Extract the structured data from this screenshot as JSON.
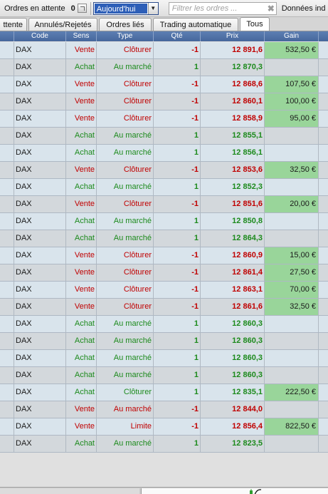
{
  "toolbar": {
    "pending_label": "Ordres en attente",
    "pending_count": "0",
    "period_value": "Aujourd'hui",
    "filter_placeholder": "Filtrer les ordres ...",
    "data_label": "Données ind"
  },
  "tabs": [
    {
      "label": "ttente",
      "active": false
    },
    {
      "label": "Annulés/Rejetés",
      "active": false
    },
    {
      "label": "Ordres liés",
      "active": false
    },
    {
      "label": "Trading automatique",
      "active": false
    },
    {
      "label": "Tous",
      "active": true
    }
  ],
  "columns": [
    "Code",
    "Sens",
    "Type",
    "Qté",
    "Prix",
    "Gain"
  ],
  "colors": {
    "sell": "#c00000",
    "buy": "#1c8a1c",
    "gain_positive": "#99d59a",
    "header": "#4f71a7"
  },
  "orders": [
    {
      "code": "DAX",
      "sens": "Vente",
      "type": "Clôturer",
      "qte": "-1",
      "prix": "12 891,6",
      "gain": "532,50 €"
    },
    {
      "code": "DAX",
      "sens": "Achat",
      "type": "Au marché",
      "qte": "1",
      "prix": "12 870,3",
      "gain": ""
    },
    {
      "code": "DAX",
      "sens": "Vente",
      "type": "Clôturer",
      "qte": "-1",
      "prix": "12 868,6",
      "gain": "107,50 €"
    },
    {
      "code": "DAX",
      "sens": "Vente",
      "type": "Clôturer",
      "qte": "-1",
      "prix": "12 860,1",
      "gain": "100,00 €"
    },
    {
      "code": "DAX",
      "sens": "Vente",
      "type": "Clôturer",
      "qte": "-1",
      "prix": "12 858,9",
      "gain": "95,00 €"
    },
    {
      "code": "DAX",
      "sens": "Achat",
      "type": "Au marché",
      "qte": "1",
      "prix": "12 855,1",
      "gain": ""
    },
    {
      "code": "DAX",
      "sens": "Achat",
      "type": "Au marché",
      "qte": "1",
      "prix": "12 856,1",
      "gain": ""
    },
    {
      "code": "DAX",
      "sens": "Vente",
      "type": "Clôturer",
      "qte": "-1",
      "prix": "12 853,6",
      "gain": "32,50 €"
    },
    {
      "code": "DAX",
      "sens": "Achat",
      "type": "Au marché",
      "qte": "1",
      "prix": "12 852,3",
      "gain": ""
    },
    {
      "code": "DAX",
      "sens": "Vente",
      "type": "Clôturer",
      "qte": "-1",
      "prix": "12 851,6",
      "gain": "20,00 €"
    },
    {
      "code": "DAX",
      "sens": "Achat",
      "type": "Au marché",
      "qte": "1",
      "prix": "12 850,8",
      "gain": ""
    },
    {
      "code": "DAX",
      "sens": "Achat",
      "type": "Au marché",
      "qte": "1",
      "prix": "12 864,3",
      "gain": ""
    },
    {
      "code": "DAX",
      "sens": "Vente",
      "type": "Clôturer",
      "qte": "-1",
      "prix": "12 860,9",
      "gain": "15,00 €"
    },
    {
      "code": "DAX",
      "sens": "Vente",
      "type": "Clôturer",
      "qte": "-1",
      "prix": "12 861,4",
      "gain": "27,50 €"
    },
    {
      "code": "DAX",
      "sens": "Vente",
      "type": "Clôturer",
      "qte": "-1",
      "prix": "12 863,1",
      "gain": "70,00 €"
    },
    {
      "code": "DAX",
      "sens": "Vente",
      "type": "Clôturer",
      "qte": "-1",
      "prix": "12 861,6",
      "gain": "32,50 €"
    },
    {
      "code": "DAX",
      "sens": "Achat",
      "type": "Au marché",
      "qte": "1",
      "prix": "12 860,3",
      "gain": ""
    },
    {
      "code": "DAX",
      "sens": "Achat",
      "type": "Au marché",
      "qte": "1",
      "prix": "12 860,3",
      "gain": ""
    },
    {
      "code": "DAX",
      "sens": "Achat",
      "type": "Au marché",
      "qte": "1",
      "prix": "12 860,3",
      "gain": ""
    },
    {
      "code": "DAX",
      "sens": "Achat",
      "type": "Au marché",
      "qte": "1",
      "prix": "12 860,3",
      "gain": ""
    },
    {
      "code": "DAX",
      "sens": "Achat",
      "type": "Clôturer",
      "qte": "1",
      "prix": "12 835,1",
      "gain": "222,50 €"
    },
    {
      "code": "DAX",
      "sens": "Vente",
      "type": "Au marché",
      "qte": "-1",
      "prix": "12 844,0",
      "gain": ""
    },
    {
      "code": "DAX",
      "sens": "Vente",
      "type": "Limite",
      "qte": "-1",
      "prix": "12 856,4",
      "gain": "822,50 €"
    },
    {
      "code": "DAX",
      "sens": "Achat",
      "type": "Au marché",
      "qte": "1",
      "prix": "12 823,5",
      "gain": ""
    }
  ]
}
